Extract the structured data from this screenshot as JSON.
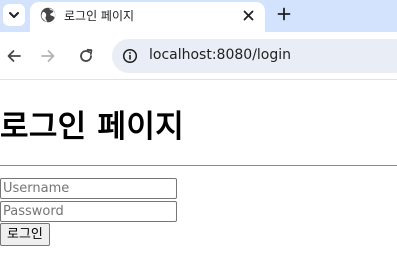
{
  "browser": {
    "tab": {
      "title": "로그인 페이지",
      "favicon": "globe-icon"
    },
    "new_tab_symbol": "+",
    "address_bar": {
      "url": "localhost:8080/login",
      "site_info_icon": "info-icon"
    },
    "colors": {
      "tabstrip_background": "#d3e3fd",
      "omnibox_background": "#e9eef6"
    }
  },
  "page": {
    "heading": "로그인 페이지",
    "form": {
      "username_placeholder": "Username",
      "password_placeholder": "Password",
      "submit_label": "로그인"
    }
  }
}
